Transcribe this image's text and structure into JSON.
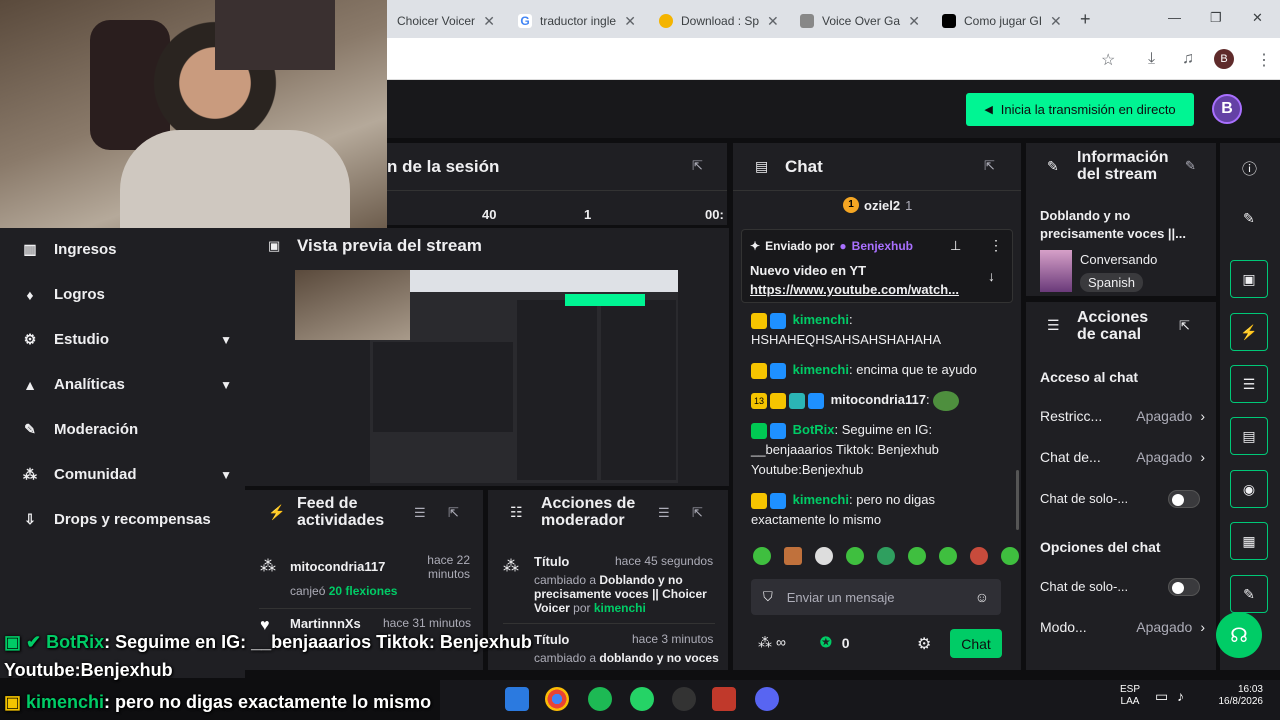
{
  "browser": {
    "tabs": [
      {
        "label": "Choicer Voicer",
        "color": "#fff"
      },
      {
        "label": "traductor ingle",
        "color": "#4285f4"
      },
      {
        "label": "Download : Sp",
        "color": "#f4b400"
      },
      {
        "label": "Voice Over Ga",
        "color": "#888"
      },
      {
        "label": "Como jugar GI",
        "color": "#000"
      }
    ],
    "new_tab": "+",
    "profile_initial": "B",
    "window_controls": [
      "—",
      "❐",
      "✕"
    ]
  },
  "topnav": {
    "go_live_label": "Inicia la transmisión en directo",
    "avatar_initial": "B"
  },
  "session": {
    "title": "n de la sesión",
    "stats": [
      "40",
      "1",
      "00:"
    ]
  },
  "sidebar": {
    "items": [
      {
        "label": "Ingresos",
        "icon": "chart-icon",
        "glyph": "▥",
        "chevron": false
      },
      {
        "label": "Logros",
        "icon": "trophy-icon",
        "glyph": "🏆",
        "chevron": false
      },
      {
        "label": "Estudio",
        "icon": "studio-icon",
        "glyph": "⚙",
        "chevron": true
      },
      {
        "label": "Analíticas",
        "icon": "analytics-icon",
        "glyph": "▲",
        "chevron": true
      },
      {
        "label": "Moderación",
        "icon": "wrench-icon",
        "glyph": "🔧",
        "chevron": false
      },
      {
        "label": "Comunidad",
        "icon": "community-icon",
        "glyph": "⁂",
        "chevron": true
      },
      {
        "label": "Drops y recompensas",
        "icon": "drops-icon",
        "glyph": "⇩",
        "chevron": false
      }
    ]
  },
  "preview": {
    "title": "Vista previa del stream"
  },
  "activity_feed": {
    "title_line1": "Feed de",
    "title_line2": "actividades",
    "items": [
      {
        "user": "mitocondria117",
        "time_line1": "hace 22",
        "time_line2": "minutos",
        "action": "canjeó",
        "reward": "20 flexiones"
      },
      {
        "user": "MartinnnXs",
        "time_line1": "hace 31 minutos",
        "time_line2": "",
        "action": "",
        "reward": ""
      }
    ]
  },
  "mod_actions": {
    "title_line1": "Acciones de",
    "title_line2": "moderador",
    "items": [
      {
        "field": "Título",
        "time": "hace 45 segundos",
        "changed_to": "cambiado a",
        "value": "Doblando y no precisamente voces || Choicer Voicer",
        "by": "por",
        "user": "kimenchi"
      },
      {
        "field": "Título",
        "time": "hace 3 minutos",
        "changed_to": "cambiado a",
        "value": "doblando y no voces",
        "by": "",
        "user": ""
      }
    ]
  },
  "chat": {
    "title": "Chat",
    "leader": {
      "rank": "1",
      "name": "oziel2",
      "count": "1"
    },
    "pinned": {
      "sent_by": "Enviado por",
      "user": "Benjexhub",
      "text": "Nuevo video en YT",
      "link": "https://www.youtube.com/watch..."
    },
    "messages": [
      {
        "user": "kimenchi",
        "user_color": "#00cc66",
        "text": "HSHAHEQHSAHSAHSHAHAHA"
      },
      {
        "user": "kimenchi",
        "user_color": "#00cc66",
        "text": "encima que te ayudo"
      },
      {
        "user": "mitocondria117",
        "user_color": "#efeff1",
        "text": ""
      },
      {
        "user": "BotRix",
        "user_color": "#00cc66",
        "text": "Seguime en IG: __benjaaarios Tiktok: Benjexhub Youtube:Benjexhub"
      },
      {
        "user": "kimenchi",
        "user_color": "#00cc66",
        "text": "pero no digas exactamente lo mismo"
      }
    ],
    "input_placeholder": "Enviar un mensaje",
    "points": "0",
    "infinity": "∞",
    "send_label": "Chat"
  },
  "stream_info": {
    "title_line1": "Información",
    "title_line2": "del stream",
    "stream_title": "Doblando y no precisamente voces ||...",
    "category": "Conversando",
    "language": "Spanish"
  },
  "channel_actions": {
    "title_line1": "Acciones",
    "title_line2": "de canal",
    "chat_access_heading": "Acceso al chat",
    "rows1": [
      {
        "label": "Restricc...",
        "value": "Apagado"
      },
      {
        "label": "Chat de...",
        "value": "Apagado"
      }
    ],
    "toggle1_label": "Chat de solo-...",
    "chat_options_heading": "Opciones del chat",
    "toggle2_label": "Chat de solo-...",
    "rows2": [
      {
        "label": "Modo...",
        "value": "Apagado"
      }
    ]
  },
  "overlay": {
    "line1_user": "BotRix",
    "line1_text": ": Seguime en IG: __benjaaarios Tiktok: Benjexhub",
    "line2_text": "Youtube:Benjexhub",
    "line3_user": "kimenchi",
    "line3_text": ": pero no digas exactamente lo mismo"
  },
  "taskbar": {
    "lang_line1": "ESP",
    "lang_line2": "LAA",
    "time": "16:03",
    "date": "16/8/2026"
  },
  "colors": {
    "twitch_purple": "#9147ff",
    "live_green": "#00f593",
    "panel_bg": "#1f1f23",
    "page_bg": "#0e0e10"
  }
}
